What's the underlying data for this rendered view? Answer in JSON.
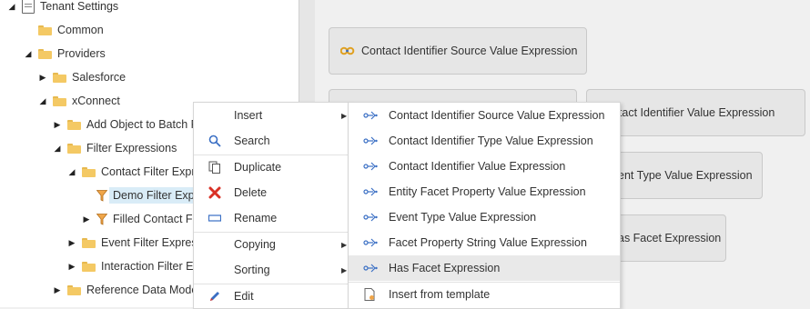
{
  "tree": {
    "items": [
      {
        "label": "Tenant Settings",
        "expanded": true,
        "icon": "doc-icon"
      },
      {
        "label": "Common",
        "icon": "folder-icon"
      },
      {
        "label": "Providers",
        "expanded": true,
        "icon": "folder-icon"
      },
      {
        "label": "Salesforce",
        "icon": "folder-icon"
      },
      {
        "label": "xConnect",
        "expanded": true,
        "icon": "folder-icon"
      },
      {
        "label": "Add Object to Batch F",
        "icon": "folder-icon"
      },
      {
        "label": "Filter Expressions",
        "expanded": true,
        "icon": "folder-icon"
      },
      {
        "label": "Contact Filter Expr",
        "expanded": true,
        "icon": "folder-icon"
      },
      {
        "label": "Demo Filter Exp",
        "icon": "funnel-icon",
        "selected": true
      },
      {
        "label": "Filled Contact F",
        "icon": "funnel-icon"
      },
      {
        "label": "Event Filter Expres",
        "icon": "folder-icon"
      },
      {
        "label": "Interaction Filter E",
        "icon": "folder-icon"
      },
      {
        "label": "Reference Data Mode",
        "icon": "folder-icon"
      }
    ]
  },
  "insert_buttons": [
    "Contact Identifier Source Value Expression",
    "Contact Identifier Value Expression",
    "ent Type Value Expression",
    "as Facet Expression"
  ],
  "context_menu": {
    "items": [
      {
        "label": "Insert",
        "icon": "none",
        "submenu": true
      },
      {
        "label": "Search",
        "icon": "search-icon"
      },
      {
        "label": "Duplicate",
        "icon": "duplicate-icon"
      },
      {
        "label": "Delete",
        "icon": "delete-icon"
      },
      {
        "label": "Rename",
        "icon": "rename-icon"
      },
      {
        "label": "Copying",
        "icon": "none",
        "submenu": true
      },
      {
        "label": "Sorting",
        "icon": "none",
        "submenu": true
      },
      {
        "label": "Edit",
        "icon": "edit-icon"
      }
    ]
  },
  "insert_submenu": {
    "items": [
      {
        "label": "Contact Identifier Source Value Expression",
        "icon": "expression-icon"
      },
      {
        "label": "Contact Identifier Type Value Expression",
        "icon": "expression-icon"
      },
      {
        "label": "Contact Identifier Value Expression",
        "icon": "expression-icon"
      },
      {
        "label": "Entity Facet Property Value Expression",
        "icon": "expression-icon"
      },
      {
        "label": "Event Type Value Expression",
        "icon": "expression-icon"
      },
      {
        "label": "Facet Property String Value Expression",
        "icon": "expression-icon"
      },
      {
        "label": "Has Facet Expression",
        "icon": "expression-icon",
        "highlighted": true
      },
      {
        "label": "Insert from template",
        "icon": "template-icon"
      }
    ]
  },
  "colors": {
    "accent_selected": "#d9ecf7",
    "delete_red": "#d93025",
    "edit_blue": "#3a6fc4",
    "folder": "#f4c964"
  }
}
